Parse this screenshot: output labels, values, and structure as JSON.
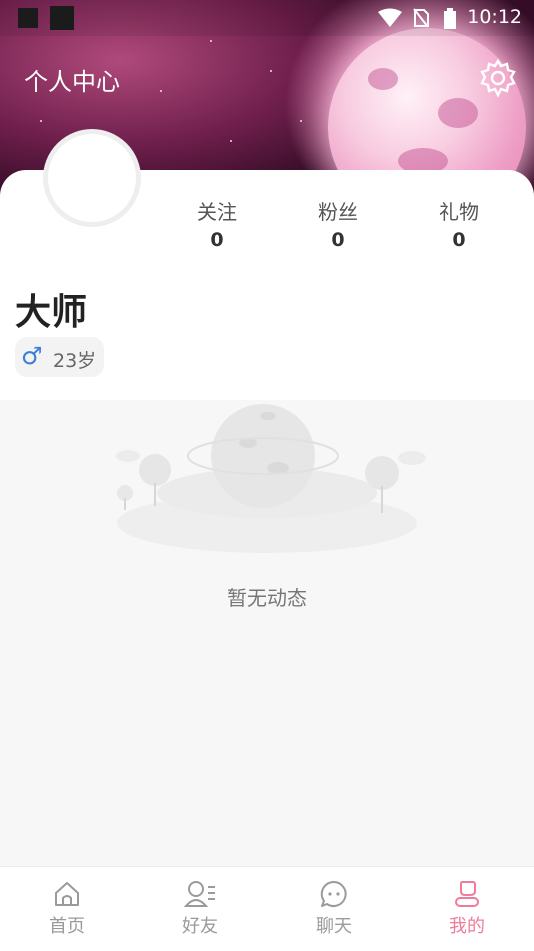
{
  "statusbar": {
    "time": "10:12"
  },
  "header": {
    "title": "个人中心",
    "settings_icon": "gear-icon"
  },
  "stats": [
    {
      "label": "关注",
      "value": "0"
    },
    {
      "label": "粉丝",
      "value": "0"
    },
    {
      "label": "礼物",
      "value": "0"
    }
  ],
  "profile": {
    "name": "大师",
    "gender_symbol": "♂",
    "age": "23岁"
  },
  "feed": {
    "empty_text": "暂无动态"
  },
  "tabs": [
    {
      "label": "首页",
      "icon": "home-icon"
    },
    {
      "label": "好友",
      "icon": "friends-icon"
    },
    {
      "label": "聊天",
      "icon": "chat-icon"
    },
    {
      "label": "我的",
      "icon": "profile-icon",
      "active": true
    }
  ],
  "colors": {
    "accent": "#ef7c9a",
    "male": "#3d7fd6",
    "header": "#8a2b5c"
  }
}
